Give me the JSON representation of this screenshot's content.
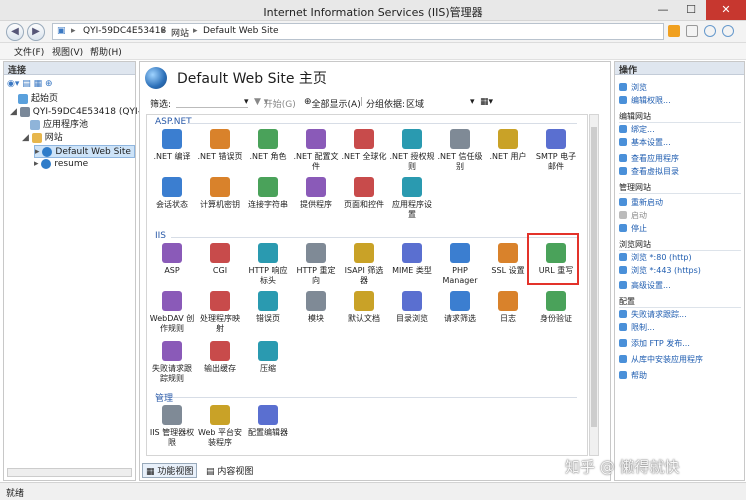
{
  "window": {
    "title": "Internet Information Services (IIS)管理器",
    "min": "—",
    "max": "☐",
    "close": "✕"
  },
  "address": {
    "back": "◀",
    "forward": "▶",
    "path": [
      "QYI-59DC4E53418",
      "网站",
      "Default Web Site"
    ],
    "sep": "▸"
  },
  "menu": [
    "文件(F)",
    "视图(V)",
    "帮助(H)"
  ],
  "connections": {
    "header": "连接",
    "tree": [
      "起始页",
      "QYI-59DC4E53418 (QYI-59",
      "应用程序池",
      "网站",
      "Default Web Site",
      "resume"
    ]
  },
  "main": {
    "title": "Default Web Site 主页",
    "filter": {
      "label": "筛选:",
      "start": "开始(G)",
      "showall": "全部显示(A)",
      "groupby": "分组依据:",
      "groupval": "区域"
    },
    "groups": [
      {
        "name": "ASP.NET",
        "items": [
          ".NET 编译",
          ".NET 错误页",
          ".NET 角色",
          ".NET 配置文件",
          ".NET 全球化",
          ".NET 授权规则",
          ".NET 信任级别",
          ".NET 用户",
          "SMTP 电子邮件",
          "会话状态",
          "计算机密钥",
          "连接字符串",
          "提供程序",
          "页面和控件",
          "应用程序设置"
        ]
      },
      {
        "name": "IIS",
        "items": [
          "ASP",
          "CGI",
          "HTTP 响应标头",
          "HTTP 重定向",
          "ISAPI 筛选器",
          "MIME 类型",
          "PHP Manager",
          "SSL 设置",
          "URL 重写",
          "WebDAV 创作规则",
          "处理程序映射",
          "错误页",
          "模块",
          "默认文档",
          "目录浏览",
          "请求筛选",
          "日志",
          "身份验证",
          "失败请求跟踪规则",
          "输出缓存",
          "压缩"
        ]
      },
      {
        "name": "管理",
        "items": [
          "IIS 管理器权限",
          "Web 平台安装程序",
          "配置编辑器"
        ]
      }
    ],
    "tabs": [
      "功能视图",
      "内容视图"
    ]
  },
  "actions": {
    "header": "操作",
    "items": [
      {
        "t": "浏览",
        "k": "link"
      },
      {
        "t": "编辑权限...",
        "k": "link"
      },
      {
        "t": "编辑网站",
        "k": "head"
      },
      {
        "t": "绑定...",
        "k": "link"
      },
      {
        "t": "基本设置...",
        "k": "link"
      },
      {
        "t": "查看应用程序",
        "k": "link"
      },
      {
        "t": "查看虚拟目录",
        "k": "link"
      },
      {
        "t": "管理网站",
        "k": "head"
      },
      {
        "t": "重新启动",
        "k": "link"
      },
      {
        "t": "启动",
        "k": "dim"
      },
      {
        "t": "停止",
        "k": "link"
      },
      {
        "t": "浏览网站",
        "k": "head"
      },
      {
        "t": "浏览 *:80 (http)",
        "k": "link"
      },
      {
        "t": "浏览 *:443 (https)",
        "k": "link"
      },
      {
        "t": "高级设置...",
        "k": "link"
      },
      {
        "t": "配置",
        "k": "head"
      },
      {
        "t": "失败请求跟踪...",
        "k": "link"
      },
      {
        "t": "限制...",
        "k": "link"
      },
      {
        "t": "添加 FTP 发布...",
        "k": "link"
      },
      {
        "t": "从库中安装应用程序",
        "k": "link"
      },
      {
        "t": "帮助",
        "k": "link"
      }
    ]
  },
  "status": "就绪",
  "watermark": "知乎 @ 懒得就快",
  "colors": {
    "accent": "#1f5db0",
    "highlight": "#e3322a",
    "selection": "#cde3f8"
  }
}
